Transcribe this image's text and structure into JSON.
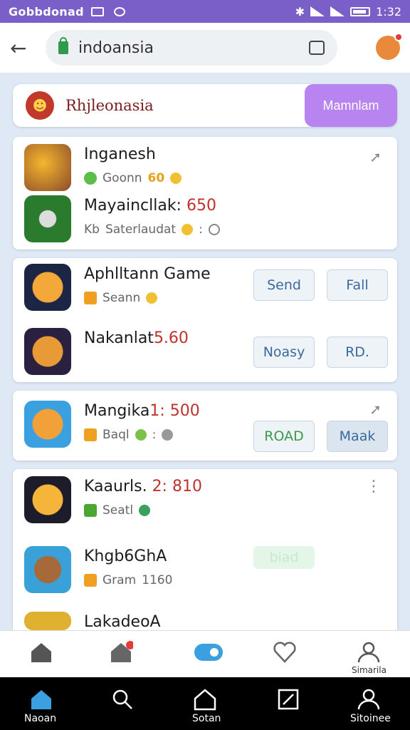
{
  "status_bar": {
    "carrier": "Gobbdonad",
    "time": "1:32"
  },
  "browser": {
    "url": "indoansia"
  },
  "banner": {
    "title": "Rhjleonasia",
    "button": "Mamnlam"
  },
  "cards": [
    {
      "rows": [
        {
          "title": "Inganesh",
          "title_num": "",
          "subtitle": "Goonn",
          "extra": "60"
        },
        {
          "title": "Mayaincllak: ",
          "title_num": "650",
          "subtitle": "Saterlaudat",
          "extra": ":",
          "prefix": "Kb"
        }
      ]
    },
    {
      "rows": [
        {
          "title": "Aphlltann Game",
          "title_num": "",
          "subtitle": "Seann",
          "btn1": "Send",
          "btn2": "Fall"
        },
        {
          "title": "Nakanlat",
          "title_num": "5.60",
          "subtitle": "",
          "btn1": "Noasy",
          "btn2": "RD."
        }
      ]
    },
    {
      "rows": [
        {
          "title": "Mangika",
          "title_num": "1: 500",
          "subtitle": "Baql",
          "extra": ":",
          "btn1": "ROAD",
          "btn2": "Maak"
        }
      ]
    },
    {
      "rows": [
        {
          "title": "Kaaurls. ",
          "title_num": "2: 810",
          "subtitle": "Seatl"
        },
        {
          "title": "Khgb6GhA",
          "title_num": "",
          "subtitle": "Gram",
          "extra": "1160",
          "btn1": "biad"
        },
        {
          "title": "LakadeoA",
          "title_num": "",
          "subtitle": ""
        }
      ]
    }
  ],
  "bottom_nav": {
    "item5_label": "Simarila"
  },
  "system_nav": {
    "labels": [
      "Naoan",
      "",
      "Sotan",
      "",
      "Sitoinee"
    ]
  },
  "colors": {
    "accent": "#7b5fc8",
    "banner_btn": "#b884f0",
    "price": "#c0322c"
  }
}
